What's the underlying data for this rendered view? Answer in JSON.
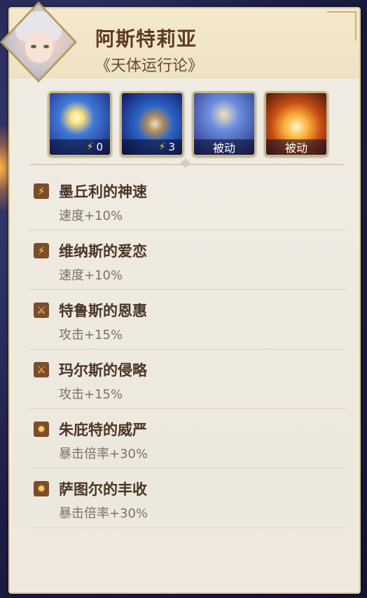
{
  "character": {
    "name": "阿斯特莉亚",
    "subtitle": "《天体运行论》"
  },
  "skills": [
    {
      "icon": "orbit-star-skill-icon",
      "cost": "0"
    },
    {
      "icon": "planet-orbit-skill-icon",
      "cost": "3"
    },
    {
      "icon": "astrea-portrait-skill-icon",
      "label": "被动"
    },
    {
      "icon": "golden-wings-skill-icon",
      "label": "被动"
    }
  ],
  "effects": [
    {
      "icon": "lightning-icon",
      "title": "墨丘利的神速",
      "stat": "速度+10%"
    },
    {
      "icon": "lightning-icon",
      "title": "维纳斯的爱恋",
      "stat": "速度+10%"
    },
    {
      "icon": "sword-icon",
      "title": "特鲁斯的恩惠",
      "stat": "攻击+15%"
    },
    {
      "icon": "sword-icon",
      "title": "玛尔斯的侵略",
      "stat": "攻击+15%"
    },
    {
      "icon": "critical-burst-icon",
      "title": "朱庇特的威严",
      "stat": "暴击倍率+30%"
    },
    {
      "icon": "critical-burst-icon",
      "title": "萨图尔的丰收",
      "stat": "暴击倍率+30%"
    }
  ]
}
